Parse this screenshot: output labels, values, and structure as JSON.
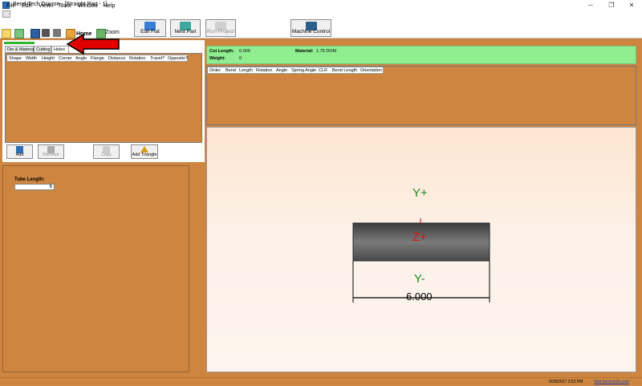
{
  "window": {
    "title": "Bend-Tech Dragon - [Straight Part - 1]"
  },
  "menu": [
    "File",
    "Edit",
    "View",
    "Tools",
    "Window",
    "Help"
  ],
  "toolbar": {
    "home_label": "Home",
    "zoom_label": "Zoom",
    "buttons": [
      "Edit Flat",
      "Nest Part",
      "Run Project",
      "Machine Control"
    ]
  },
  "left_panel": {
    "tabs": [
      "Die & Material",
      "Cutting",
      "Holes"
    ],
    "columns": [
      "Shape",
      "Width",
      "Height",
      "Corner",
      "Angle",
      "Flange",
      "Distance",
      "Rotation",
      "Travel?",
      "Opposite?"
    ],
    "buttons": [
      "Add",
      "Remove",
      "Copy",
      "Add Triangle"
    ]
  },
  "tube": {
    "label": "Tube Length:",
    "value": "6"
  },
  "info": {
    "cut_length_label": "Cut Length:",
    "cut_length_value": "6.000",
    "material_label": "Material:",
    "material_value": "1.75 DOM",
    "weight_label": "Weight:",
    "weight_value": "0"
  },
  "bend_columns": [
    "Order",
    "Bend",
    "Length",
    "Rotation",
    "Angle",
    "Spring Angle",
    "CLR",
    "Bend Length",
    "Orientation"
  ],
  "view": {
    "y_plus": "Y+",
    "z_plus": "Z+",
    "y_minus": "Y-",
    "dimension": "6.000"
  },
  "status": {
    "datetime": "9/28/2017  2:53 PM",
    "link": "Visit bend-tech.com"
  },
  "colors": {
    "accent": "#cd853f",
    "info_bg": "#90ee90",
    "arrow": "#e00000"
  }
}
